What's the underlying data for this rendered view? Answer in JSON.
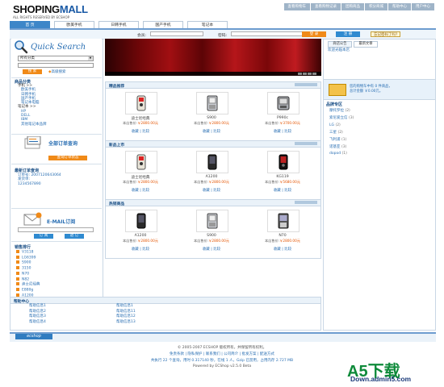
{
  "header": {
    "logo_main": "SHOPING",
    "logo_accent": "MALL",
    "tagline": "ALL RIGHTS RESERVED BY ECSHOP",
    "top_links": [
      "查看购物车",
      "查看购物记录",
      "团购商品",
      "积分商城",
      "帮助中心",
      "用户中心"
    ]
  },
  "nav": {
    "tabs": [
      {
        "label": "首 页",
        "active": true
      },
      {
        "label": "欧美手机",
        "active": false
      },
      {
        "label": "日韩手机",
        "active": false
      },
      {
        "label": "国产手机",
        "active": false
      },
      {
        "label": "笔记本",
        "active": false
      }
    ]
  },
  "login": {
    "user_label": "会员:",
    "pass_label": "密码:",
    "login_btn": "登 录",
    "register_btn": "注 册",
    "forgot_link": "忘记密码了吗?"
  },
  "quick_search": {
    "title": "Quick Search",
    "select_value": "所有分类",
    "search_btn": "搜 索",
    "advanced_link": "高级搜索"
  },
  "categories": {
    "title": "商品分类",
    "items": [
      {
        "label": "手机 >>",
        "main": true
      },
      {
        "label": "欧美手机",
        "main": false
      },
      {
        "label": "日韩手机",
        "main": false
      },
      {
        "label": "国产手机",
        "main": false
      },
      {
        "label": "笔记本电脑",
        "main": false
      },
      {
        "label": "笔记本 >>",
        "main": true
      },
      {
        "label": "HP",
        "main": false
      },
      {
        "label": "DELL",
        "main": false
      },
      {
        "label": "IBM",
        "main": false
      },
      {
        "label": "其他笔记本品牌",
        "main": false
      }
    ]
  },
  "order_query": {
    "title": "全部订单查询",
    "btn": "查询订单状态"
  },
  "recent_query": {
    "title": "最新订单查询",
    "lines": [
      "订单号: 2007120643064",
      "发货单:",
      "1234567890"
    ]
  },
  "email": {
    "title": "E-MAIL订阅",
    "subscribe_btn": "订 阅",
    "unsubscribe_btn": "退 订"
  },
  "top_sales": {
    "title": "销售排行",
    "items": [
      "V3118",
      "LG6399",
      "S900",
      "3150",
      "N70",
      "N82",
      "迪士尼经典",
      "E880g",
      "A1200"
    ]
  },
  "slider": {
    "page_count": 4
  },
  "sections": [
    {
      "title": "精品推荐",
      "products": [
        {
          "name": "迪士尼经典",
          "market_label": "市场价格:",
          "market": "2800.00",
          "price_label": "本店售价:",
          "price": "2800.00",
          "act_buy": "收藏",
          "act_cmp": "比较",
          "phone": "disney"
        },
        {
          "name": "S900",
          "market_label": "市场价格:",
          "market": "2800.00",
          "price_label": "本店售价:",
          "price": "2800.00",
          "act_buy": "收藏",
          "act_cmp": "比较",
          "phone": "silver"
        },
        {
          "name": "P990c",
          "market_label": "市场价格:",
          "market": "3700.00",
          "price_label": "本店售价:",
          "price": "3700.00",
          "act_buy": "收藏",
          "act_cmp": "比较",
          "phone": "gray"
        }
      ]
    },
    {
      "title": "新品上市",
      "products": [
        {
          "name": "迪士尼经典",
          "market_label": "市场价格:",
          "market": "2800.00",
          "price_label": "本店售价:",
          "price": "2800.00",
          "act_buy": "收藏",
          "act_cmp": "比较",
          "phone": "disney"
        },
        {
          "name": "A1200",
          "market_label": "市场价格:",
          "market": "2800.00",
          "price_label": "本店售价:",
          "price": "2800.00",
          "act_buy": "收藏",
          "act_cmp": "比较",
          "phone": "black"
        },
        {
          "name": "KG119",
          "market_label": "市场价格:",
          "market": "5680.00",
          "price_label": "本店售价:",
          "price": "5680.00",
          "act_buy": "收藏",
          "act_cmp": "比较",
          "phone": "redblack"
        }
      ]
    },
    {
      "title": "热销商品",
      "products": [
        {
          "name": "A1200",
          "market_label": "市场价格:",
          "market": "2800.00",
          "price_label": "本店售价:",
          "price": "2800.00",
          "act_buy": "收藏",
          "act_cmp": "比较",
          "phone": "black"
        },
        {
          "name": "S900",
          "market_label": "市场价格:",
          "market": "2800.00",
          "price_label": "本店售价:",
          "price": "2800.00",
          "act_buy": "收藏",
          "act_cmp": "比较",
          "phone": "silver"
        },
        {
          "name": "N70",
          "market_label": "市场价格:",
          "market": "2800.00",
          "price_label": "本店售价:",
          "price": "2800.00",
          "act_buy": "收藏",
          "act_cmp": "比较",
          "phone": "n70"
        }
      ]
    }
  ],
  "right": {
    "tabs": [
      "商店公告",
      "最新文章"
    ],
    "notice": "欢迎光临本店",
    "cart_line1": "您的购物车中有 0 件商品，",
    "cart_line2": "总计金额 ￥0.00元。",
    "brand_title": "品牌专区",
    "brands": [
      {
        "name": "摩托罗拉",
        "count": "(2)"
      },
      {
        "name": "索尼爱立信",
        "count": "(3)"
      },
      {
        "name": "LG",
        "count": "(2)"
      },
      {
        "name": "三星",
        "count": "(2)"
      },
      {
        "name": "飞利浦",
        "count": "(1)"
      },
      {
        "name": "诺基亚",
        "count": "(3)"
      },
      {
        "name": "dopod",
        "count": "(1)"
      }
    ]
  },
  "help": {
    "title": "帮助中心",
    "col1": [
      "帮助信息1",
      "帮助信息2",
      "帮助信息3",
      "帮助信息4"
    ],
    "col2": [
      "帮助信息1",
      "帮助信息11",
      "帮助信息12",
      "帮助信息13"
    ]
  },
  "footer": {
    "logo": "ecshop",
    "copyright": "© 2005-2007 ECSHOP 版权所有，并保留所有权利。",
    "links": "免责条款 | 隐私保护 | 联系我们 | 公司简介 | 批发方案 | 配送方式",
    "line3": "共执行 22 个查询，用时 0.317140 秒，在线 1 人，Gzip 已禁用，占用内存 2.727 MB",
    "powered": "Powered by ECShop v2.5.0 Beta"
  },
  "watermark": {
    "big": "A5下载",
    "small": "Down.admin5.com"
  }
}
